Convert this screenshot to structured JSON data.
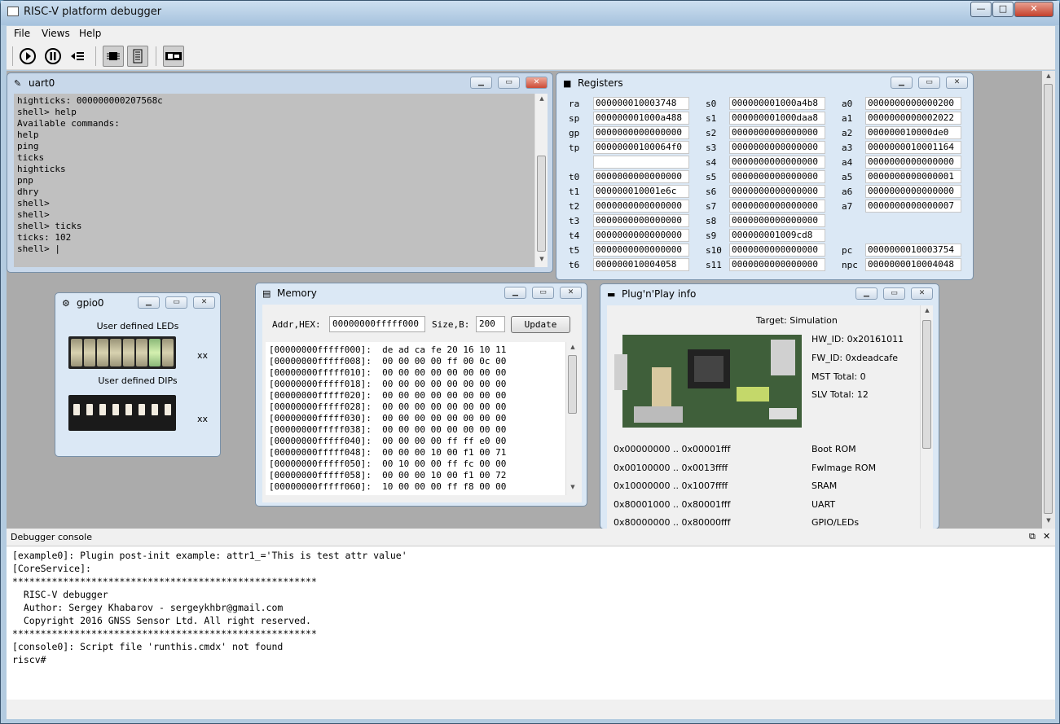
{
  "app": {
    "title": "RISC-V platform debugger",
    "win_min": "—",
    "win_max": "□",
    "win_close": "✕"
  },
  "menu": [
    "File",
    "Views",
    "Help"
  ],
  "toolbar": {
    "icons": [
      "run-icon",
      "halt-icon",
      "step-icon",
      "cpu-icon",
      "memory-icon",
      "board-icon"
    ]
  },
  "uart": {
    "title": "uart0",
    "lines": "highticks: 000000000207568c\nshell> help\nAvailable commands:\nhelp\nping\nticks\nhighticks\npnp\ndhry\nshell>\nshell>\nshell> ticks\nticks: 102\nshell> |"
  },
  "registers": {
    "title": "Registers",
    "col1": [
      {
        "name": "ra",
        "value": "000000010003748"
      },
      {
        "name": "sp",
        "value": "000000001000a488"
      },
      {
        "name": "gp",
        "value": "0000000000000000"
      },
      {
        "name": "tp",
        "value": "00000000100064f0"
      },
      {
        "name": "",
        "value": ""
      },
      {
        "name": "t0",
        "value": "0000000000000000"
      },
      {
        "name": "t1",
        "value": "000000010001e6c"
      },
      {
        "name": "t2",
        "value": "0000000000000000"
      },
      {
        "name": "t3",
        "value": "0000000000000000"
      },
      {
        "name": "t4",
        "value": "0000000000000000"
      },
      {
        "name": "t5",
        "value": "0000000000000000"
      },
      {
        "name": "t6",
        "value": "000000010004058"
      }
    ],
    "col2": [
      {
        "name": "s0",
        "value": "000000001000a4b8"
      },
      {
        "name": "s1",
        "value": "000000001000daa8"
      },
      {
        "name": "s2",
        "value": "0000000000000000"
      },
      {
        "name": "s3",
        "value": "0000000000000000"
      },
      {
        "name": "s4",
        "value": "0000000000000000"
      },
      {
        "name": "s5",
        "value": "0000000000000000"
      },
      {
        "name": "s6",
        "value": "0000000000000000"
      },
      {
        "name": "s7",
        "value": "0000000000000000"
      },
      {
        "name": "s8",
        "value": "0000000000000000"
      },
      {
        "name": "s9",
        "value": "000000001009cd8"
      },
      {
        "name": "s10",
        "value": "0000000000000000"
      },
      {
        "name": "s11",
        "value": "0000000000000000"
      }
    ],
    "col3": [
      {
        "name": "a0",
        "value": "0000000000000200"
      },
      {
        "name": "a1",
        "value": "0000000000002022"
      },
      {
        "name": "a2",
        "value": "000000010000de0"
      },
      {
        "name": "a3",
        "value": "0000000010001164"
      },
      {
        "name": "a4",
        "value": "0000000000000000"
      },
      {
        "name": "a5",
        "value": "0000000000000001"
      },
      {
        "name": "a6",
        "value": "0000000000000000"
      },
      {
        "name": "a7",
        "value": "0000000000000007"
      },
      {
        "name": "",
        "value": ""
      },
      {
        "name": "",
        "value": ""
      },
      {
        "name": "pc",
        "value": "0000000010003754"
      },
      {
        "name": "npc",
        "value": "0000000010004048"
      }
    ]
  },
  "gpio": {
    "title": "gpio0",
    "leds_label": "User defined LEDs",
    "dips_label": "User defined DIPs",
    "leds_value": "xx",
    "dips_value": "xx",
    "leds_on_index": 6
  },
  "memory": {
    "title": "Memory",
    "addr_label": "Addr,HEX:",
    "addr_value": "00000000fffff000",
    "size_label": "Size,B:",
    "size_value": "200",
    "update": "Update",
    "dump": "[00000000fffff000]:  de ad ca fe 20 16 10 11\n[00000000fffff008]:  00 00 00 00 ff 00 0c 00\n[00000000fffff010]:  00 00 00 00 00 00 00 00\n[00000000fffff018]:  00 00 00 00 00 00 00 00\n[00000000fffff020]:  00 00 00 00 00 00 00 00\n[00000000fffff028]:  00 00 00 00 00 00 00 00\n[00000000fffff030]:  00 00 00 00 00 00 00 00\n[00000000fffff038]:  00 00 00 00 00 00 00 00\n[00000000fffff040]:  00 00 00 00 ff ff e0 00\n[00000000fffff048]:  00 00 00 10 00 f1 00 71\n[00000000fffff050]:  00 10 00 00 ff fc 00 00\n[00000000fffff058]:  00 00 00 10 00 f1 00 72\n[00000000fffff060]:  10 00 00 00 ff f8 00 00"
  },
  "pnp": {
    "title": "Plug'n'Play info",
    "target": "Target: Simulation",
    "hw_id": "HW_ID: 0x20161011",
    "fw_id": "FW_ID: 0xdeadcafe",
    "mst": "MST Total: 0",
    "slv": "SLV Total: 12",
    "rows": [
      {
        "range": "0x00000000 .. 0x00001fff",
        "name": "Boot ROM"
      },
      {
        "range": "0x00100000 .. 0x0013ffff",
        "name": "FwImage ROM"
      },
      {
        "range": "0x10000000 .. 0x1007ffff",
        "name": "SRAM"
      },
      {
        "range": "0x80001000 .. 0x80001fff",
        "name": "UART"
      },
      {
        "range": "0x80000000 .. 0x80000fff",
        "name": "GPIO/LEDs"
      }
    ]
  },
  "console": {
    "title": "Debugger console",
    "text": "[example0]: Plugin post-init example: attr1_='This is test attr value'\n[CoreService]:\n******************************************************\n  RISC-V debugger\n  Author: Sergey Khabarov - sergeykhbr@gmail.com\n  Copyright 2016 GNSS Sensor Ltd. All right reserved.\n******************************************************\n[console0]: Script file 'runthis.cmdx' not found\nriscv#"
  },
  "colors": {
    "mdi_bg": "#ababab",
    "uart_bg": "#c0c0c0",
    "subwindow_frame": "#dbe8f5"
  }
}
